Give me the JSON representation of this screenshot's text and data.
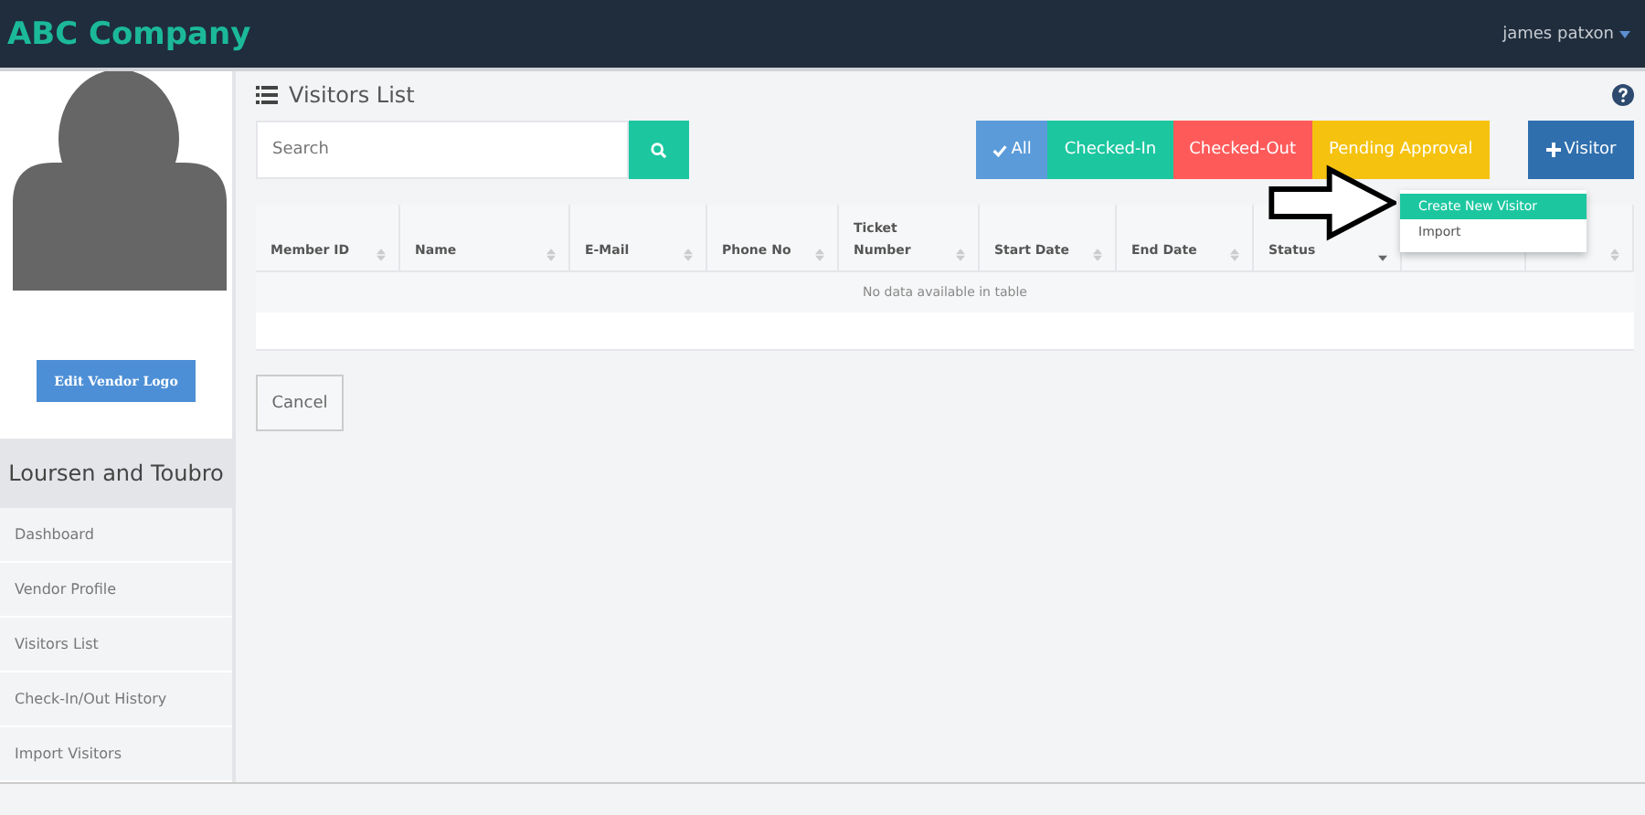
{
  "topbar": {
    "brand": "ABC Company",
    "user": "james patxon"
  },
  "sidebar": {
    "logo_button": "Edit Vendor Logo",
    "company": "Loursen and Toubro",
    "items": [
      {
        "label": "Dashboard"
      },
      {
        "label": "Vendor Profile"
      },
      {
        "label": "Visitors List"
      },
      {
        "label": "Check-In/Out History"
      },
      {
        "label": "Import Visitors"
      }
    ]
  },
  "page": {
    "title": "Visitors List",
    "search": {
      "placeholder": "Search"
    },
    "filters": [
      {
        "label": "All",
        "color": "#5b9bd9",
        "check": true
      },
      {
        "label": "Checked-In",
        "color": "#1cc7a0",
        "check": false
      },
      {
        "label": "Checked-Out",
        "color": "#ff5a5a",
        "check": false
      },
      {
        "label": "Pending Approval",
        "color": "#f5c20f",
        "check": false
      }
    ],
    "add_button": "Visitor",
    "menu": [
      {
        "label": "Create New Visitor",
        "selected": true
      },
      {
        "label": "Import",
        "selected": false
      }
    ],
    "table": {
      "columns": [
        {
          "label": "Member ID",
          "kind": "sortable"
        },
        {
          "label": "Name",
          "kind": "sortable"
        },
        {
          "label": "E-Mail",
          "kind": "sortable"
        },
        {
          "label": "Phone No",
          "kind": "sortable"
        },
        {
          "label": "Ticket Number",
          "kind": "sortable"
        },
        {
          "label": "Start Date",
          "kind": "sortable"
        },
        {
          "label": "End Date",
          "kind": "sortable"
        },
        {
          "label": "Status",
          "kind": "sorted"
        },
        {
          "kind": "plain"
        },
        {
          "kind": "sortable"
        }
      ],
      "empty": "No data available in table"
    },
    "cancel": "Cancel"
  }
}
